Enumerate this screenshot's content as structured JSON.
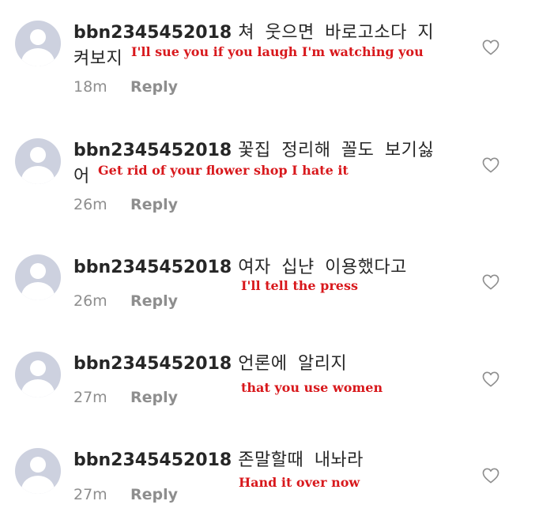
{
  "comments": [
    {
      "username": "bbn2345452018",
      "text": "쳐 웃으면 바로고소다 지 켜보지",
      "translation": "I'll sue you if you laugh I'm watching you",
      "time": "18m",
      "reply_label": "Reply",
      "like_icon": "heart-outline-icon"
    },
    {
      "username": "bbn2345452018",
      "text": "꽃집 정리해 꼴도 보기싫 어",
      "translation": "Get rid of your flower shop I hate it",
      "time": "26m",
      "reply_label": "Reply",
      "like_icon": "heart-outline-icon"
    },
    {
      "username": "bbn2345452018",
      "text": "여자 십냔 이용했다고",
      "translation": "I'll tell the press",
      "time": "26m",
      "reply_label": "Reply",
      "like_icon": "heart-outline-icon"
    },
    {
      "username": "bbn2345452018",
      "text": "언론에 알리지",
      "translation": "that you use women",
      "time": "27m",
      "reply_label": "Reply",
      "like_icon": "heart-outline-icon"
    },
    {
      "username": "bbn2345452018",
      "text": "존말할때 내놔라",
      "translation": "Hand it over now",
      "time": "27m",
      "reply_label": "Reply",
      "like_icon": "heart-outline-icon"
    }
  ],
  "colors": {
    "translation": "#d8181c",
    "muted": "#8e8e8e",
    "avatar": "#cdd1df"
  }
}
